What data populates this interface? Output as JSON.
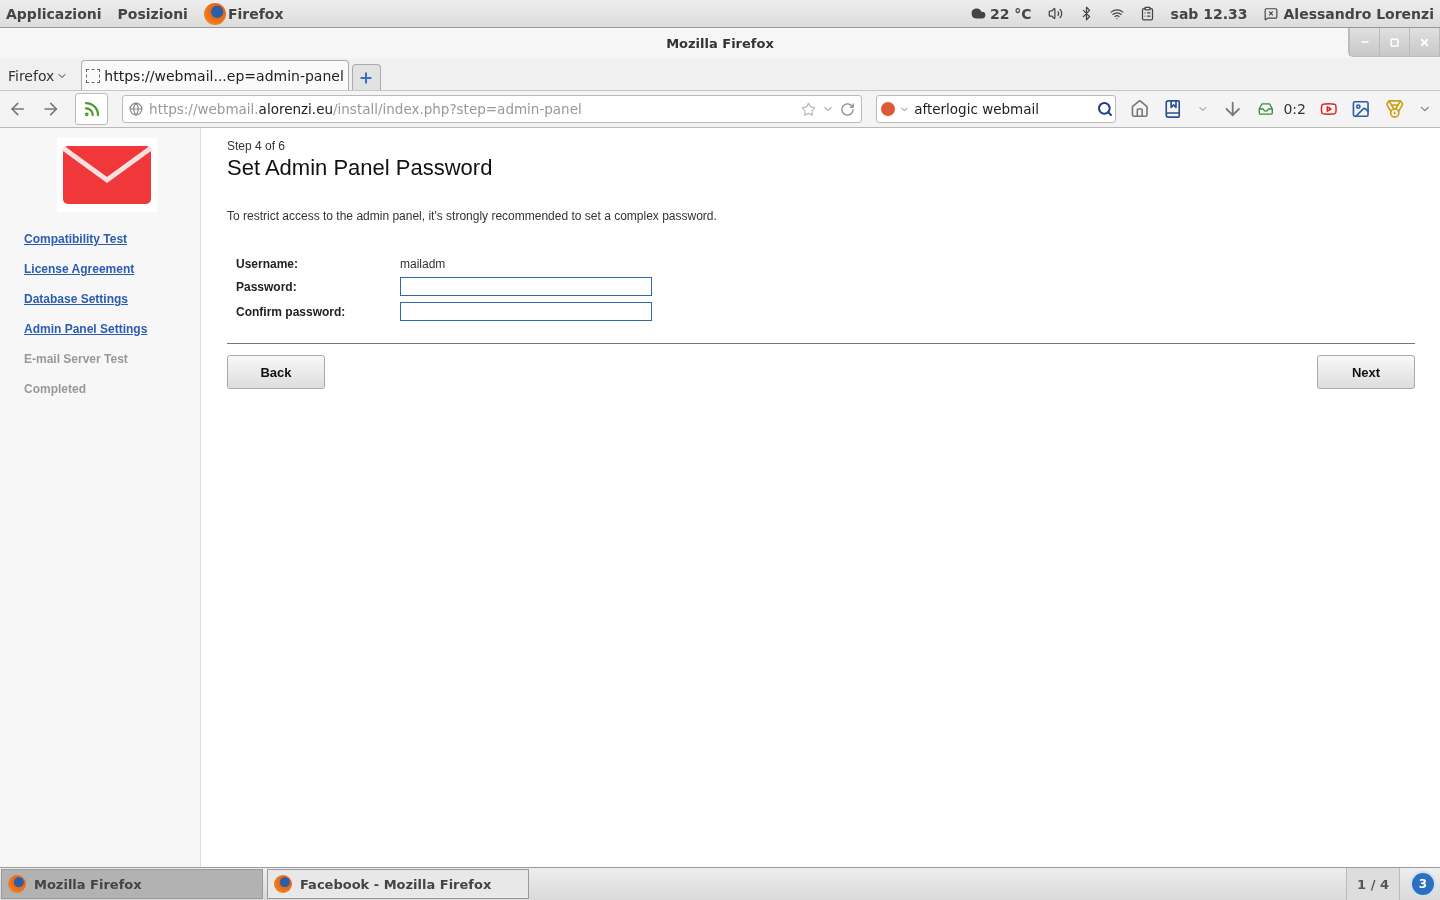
{
  "top_panel": {
    "menus": [
      "Applicazioni",
      "Posizioni"
    ],
    "active_app": "Firefox",
    "weather": "22 °C",
    "clock": "sab 12.33",
    "user": "Alessandro Lorenzi"
  },
  "window": {
    "title": "Mozilla Firefox"
  },
  "browser": {
    "menu_button": "Firefox",
    "tabs": [
      {
        "label": "https://webmail...ep=admin-panel",
        "selected": true
      }
    ],
    "url": {
      "prefix": "https://webmail.",
      "domain": "alorenzi.eu",
      "path": "/install/index.php?step=admin-panel"
    },
    "search": {
      "value": "afterlogic webmail"
    },
    "counter": "0:2"
  },
  "sidebar": {
    "items": [
      {
        "label": "Compatibility Test",
        "enabled": true
      },
      {
        "label": "License Agreement",
        "enabled": true
      },
      {
        "label": "Database Settings",
        "enabled": true
      },
      {
        "label": "Admin Panel Settings",
        "enabled": true
      },
      {
        "label": "E-mail Server Test",
        "enabled": false
      },
      {
        "label": "Completed",
        "enabled": false
      }
    ]
  },
  "main": {
    "step": "Step 4 of 6",
    "title": "Set Admin Panel Password",
    "description": "To restrict access to the admin panel, it's strongly recommended to set a complex password.",
    "fields": [
      {
        "kind": "text",
        "label": "Username:",
        "value": "mailadm"
      },
      {
        "kind": "input",
        "label": "Password:"
      },
      {
        "kind": "input",
        "label": "Confirm password:"
      }
    ],
    "buttons": {
      "back": "Back",
      "next": "Next"
    }
  },
  "taskbar": {
    "items": [
      {
        "label": "Mozilla Firefox",
        "selected": true
      },
      {
        "label": "Facebook - Mozilla Firefox",
        "selected": false
      }
    ],
    "workspace": "1 / 4",
    "notifications": "3"
  }
}
